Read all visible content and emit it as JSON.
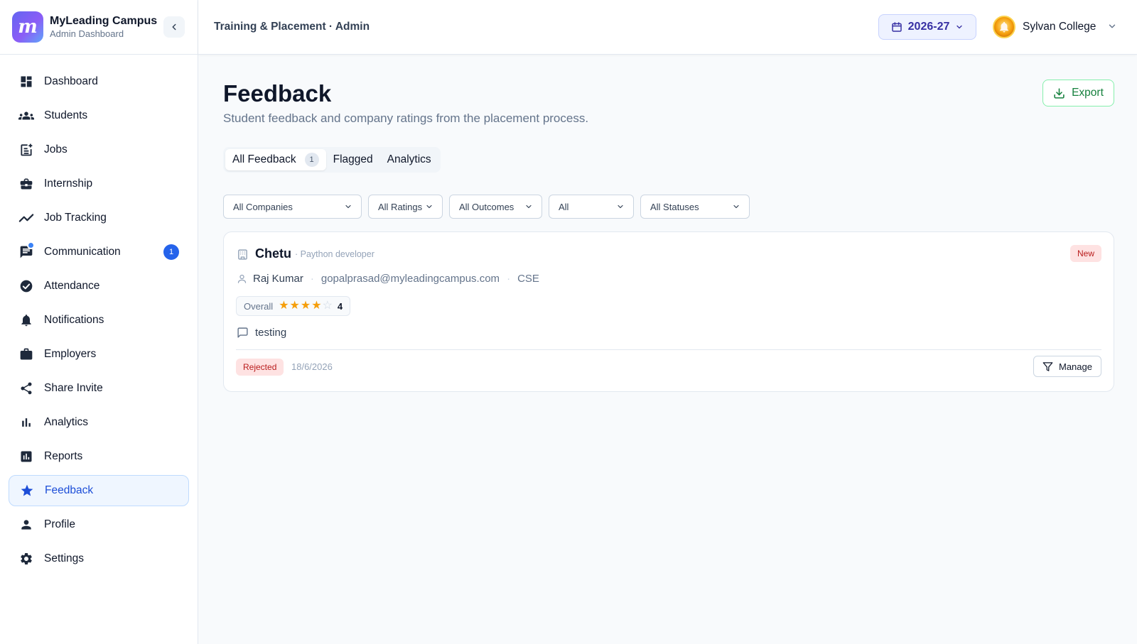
{
  "brand": {
    "logo_letter": "m",
    "name": "MyLeading Campus",
    "subtitle": "Admin Dashboard"
  },
  "sidebar": {
    "items": [
      {
        "label": "Dashboard",
        "icon": "dashboard-icon"
      },
      {
        "label": "Students",
        "icon": "students-icon"
      },
      {
        "label": "Jobs",
        "icon": "jobs-icon"
      },
      {
        "label": "Internship",
        "icon": "internship-icon"
      },
      {
        "label": "Job Tracking",
        "icon": "job-tracking-icon"
      },
      {
        "label": "Communication",
        "icon": "communication-icon",
        "badge": "1"
      },
      {
        "label": "Attendance",
        "icon": "attendance-icon"
      },
      {
        "label": "Notifications",
        "icon": "bell-icon"
      },
      {
        "label": "Employers",
        "icon": "briefcase-icon"
      },
      {
        "label": "Share Invite",
        "icon": "share-icon"
      },
      {
        "label": "Analytics",
        "icon": "bar-chart-icon"
      },
      {
        "label": "Reports",
        "icon": "reports-icon"
      },
      {
        "label": "Feedback",
        "icon": "star-icon",
        "active": true
      },
      {
        "label": "Profile",
        "icon": "person-icon"
      },
      {
        "label": "Settings",
        "icon": "gear-icon"
      }
    ]
  },
  "header": {
    "breadcrumb": "Training & Placement · Admin",
    "academic_year": "2026-27",
    "college_name": "Sylvan College"
  },
  "page": {
    "title": "Feedback",
    "subtitle": "Student feedback and company ratings from the placement process.",
    "export_label": "Export"
  },
  "tabs": [
    {
      "label": "All Feedback",
      "count": "1",
      "active": true
    },
    {
      "label": "Flagged"
    },
    {
      "label": "Analytics"
    }
  ],
  "filters": [
    "All Companies",
    "All Ratings",
    "All Outcomes",
    "All",
    "All Statuses"
  ],
  "feedback_card": {
    "company": "Chetu",
    "role": "· Paython developer",
    "badge": "New",
    "student_name": "Raj Kumar",
    "email": "gopalprasad@myleadingcampus.com",
    "department": "CSE",
    "rating_label": "Overall",
    "rating_value": "4",
    "rating_max": 5,
    "comment": "testing",
    "status": "Rejected",
    "date": "18/6/2026",
    "manage_label": "Manage"
  },
  "colors": {
    "accent": "#2563eb",
    "active_bg": "#eff6ff",
    "export_green": "#15803d",
    "star": "#f59e0b",
    "danger": "#b91c1c"
  }
}
